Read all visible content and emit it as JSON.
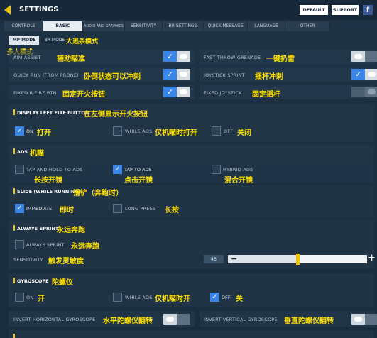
{
  "header": {
    "title": "SETTINGS",
    "default_label": "DEFAULT",
    "support_label": "SUPPORT",
    "fb_label": "f"
  },
  "tabs": [
    "CONTROLS",
    "BASIC",
    "AUDIO AND GRAPHICS",
    "SENSITIVITY",
    "BR SETTINGS",
    "QUICK MESSAGE",
    "LANGUAGE",
    "OTHER"
  ],
  "subtabs": {
    "mp": "MP MODE",
    "br": "BR MODE",
    "br_cn": "大逃杀模式",
    "mp_cn": "多人模式"
  },
  "rows": {
    "aim_assist": {
      "label": "AIM ASSIST",
      "cn": "辅助瞄准"
    },
    "fast_throw": {
      "label": "FAST THROW GRENADE",
      "cn": "一键扔雷"
    },
    "quick_run": {
      "label": "QUICK RUN (FROM PRONE)",
      "cn": "卧倒状态可以冲刺"
    },
    "joystick_sprint": {
      "label": "JOYSTICK SPRINT",
      "cn": "摇杆冲刺"
    },
    "fixed_fire": {
      "label": "FIXED R-FIRE BTN",
      "cn": "固定开火按钮"
    },
    "fixed_joystick": {
      "label": "FIXED JOYSTICK",
      "cn": "固定摇杆"
    }
  },
  "display_left_fire": {
    "title": "DISPLAY LEFT FIRE BUTTON",
    "title_cn": "在左侧显示开火按钮",
    "on": "ON",
    "on_cn": "打开",
    "while_ads": "WHILE ADS",
    "while_ads_cn": "仅机瞄时打开",
    "off": "OFF",
    "off_cn": "关闭"
  },
  "ads": {
    "title": "ADS",
    "title_cn": "机瞄",
    "hold": "TAP AND HOLD TO ADS",
    "hold_cn": "长按开镜",
    "tap": "TAP TO ADS",
    "tap_cn": "点击开镜",
    "hybrid": "HYBRID ADS",
    "hybrid_cn": "混合开镜"
  },
  "slide": {
    "title": "SLIDE (WHILE RUNNING)",
    "title_cn": "滑铲（奔跑时）",
    "immediate": "IMMEDIATE",
    "immediate_cn": "即时",
    "long_press": "LONG PRESS",
    "long_press_cn": "长按"
  },
  "always_sprint": {
    "title": "ALWAYS SPRINT",
    "title_cn": "永远奔跑",
    "option": "ALWAYS SPRINT",
    "option_cn": "永远奔跑",
    "sensitivity": "SENSITIVITY",
    "sensitivity_cn": "触发灵敏度",
    "value": "45",
    "minus": "−",
    "plus": "+",
    "slider_fraction": 0.49
  },
  "gyroscope": {
    "title": "GYROSCOPE",
    "title_cn": "陀螺仪",
    "on": "ON",
    "on_cn": "开",
    "while_ads": "WHILE ADS",
    "while_ads_cn": "仅机瞄时开",
    "off": "OFF",
    "off_cn": "关"
  },
  "invert": {
    "horizontal": "INVERT HORIZONTAL GYROSCOPE",
    "horizontal_cn": "水平陀螺仪翻转",
    "vertical": "INVERT VERTICAL GYROSCOPE",
    "vertical_cn": "垂直陀螺仪翻转"
  },
  "colors": {
    "accent": "#f5c400",
    "toggle_on": "#3a86e8",
    "cn_text": "#ffe100"
  }
}
